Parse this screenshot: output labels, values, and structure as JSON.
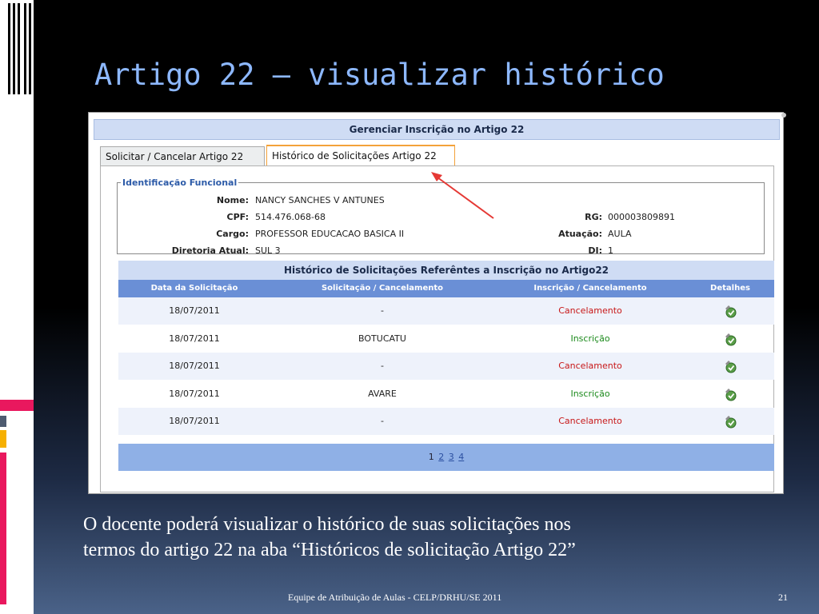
{
  "slide": {
    "title": "Artigo 22 – visualizar histórico",
    "caption_line1": "O docente poderá visualizar o histórico de suas solicitações nos",
    "caption_line2": "termos do artigo 22 na aba  “Históricos de solicitação Artigo  22”",
    "footer": "Equipe de Atribuição de Aulas - CELP/DRHU/SE  2011",
    "page_number": "21"
  },
  "app": {
    "header": "Gerenciar Inscrição no Artigo 22",
    "tabs": [
      {
        "label": "Solicitar / Cancelar Artigo 22",
        "active": false
      },
      {
        "label": "Histórico de Solicitações Artigo 22",
        "active": true
      }
    ],
    "identificacao": {
      "legend": "Identificação Funcional",
      "nome_label": "Nome:",
      "nome": "NANCY SANCHES V ANTUNES",
      "cpf_label": "CPF:",
      "cpf": "514.476.068-68",
      "cargo_label": "Cargo:",
      "cargo": "PROFESSOR EDUCACAO BASICA II",
      "diretoria_label": "Diretoria Atual:",
      "diretoria": "SUL 3",
      "rg_label": "RG:",
      "rg": "000003809891",
      "atuacao_label": "Atuação:",
      "atuacao": "AULA",
      "di_label": "DI:",
      "di": "1"
    },
    "historico": {
      "title": "Histórico de Solicitações Referêntes a Inscrição no Artigo22",
      "columns": [
        "Data da Solicitação",
        "Solicitação / Cancelamento",
        "Inscrição / Cancelamento",
        "Detalhes"
      ],
      "rows": [
        {
          "data": "18/07/2011",
          "solicitacao": "-",
          "status": "Cancelamento"
        },
        {
          "data": "18/07/2011",
          "solicitacao": "BOTUCATU",
          "status": "Inscrição"
        },
        {
          "data": "18/07/2011",
          "solicitacao": "-",
          "status": "Cancelamento"
        },
        {
          "data": "18/07/2011",
          "solicitacao": "AVARE",
          "status": "Inscrição"
        },
        {
          "data": "18/07/2011",
          "solicitacao": "-",
          "status": "Cancelamento"
        }
      ],
      "pages": [
        "1",
        "2",
        "3",
        "4"
      ],
      "current_page": "1"
    },
    "colors": {
      "header_bg": "#cfdcf4",
      "column_header_bg": "#6a8fd6",
      "pager_bg": "#8fb0e6",
      "cancel": "#c81818",
      "inscricao": "#1b8a1b",
      "active_tab_border": "#f3a23a",
      "title": "#8db8ff",
      "arrow": "#e53935"
    }
  }
}
